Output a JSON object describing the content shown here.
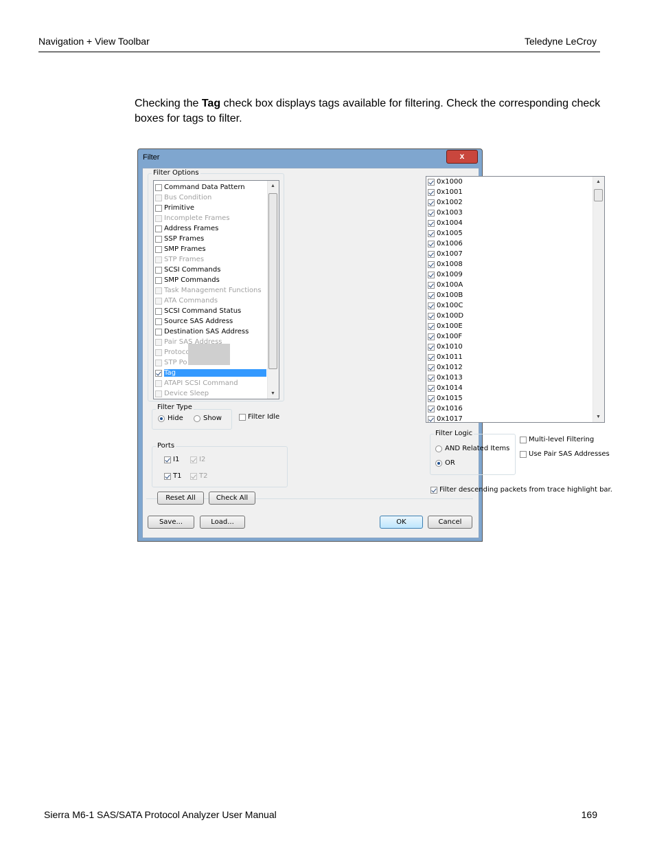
{
  "header": {
    "left": "Navigation + View Toolbar",
    "right": "Teledyne LeCroy"
  },
  "intro": {
    "before": "Checking the ",
    "bold": "Tag",
    "after": " check box displays tags available for filtering. Check the corresponding check boxes for tags to filter."
  },
  "dialog": {
    "title": "Filter",
    "close": "x",
    "filter_options_label": "Filter Options",
    "options": [
      {
        "label": "Command Data Pattern",
        "checked": false,
        "enabled": true
      },
      {
        "label": "Bus Condition",
        "checked": false,
        "enabled": false
      },
      {
        "label": "Primitive",
        "checked": false,
        "enabled": true
      },
      {
        "label": "Incomplete Frames",
        "checked": false,
        "enabled": false
      },
      {
        "label": "Address Frames",
        "checked": false,
        "enabled": true
      },
      {
        "label": "SSP Frames",
        "checked": false,
        "enabled": true
      },
      {
        "label": "SMP Frames",
        "checked": false,
        "enabled": true
      },
      {
        "label": "STP Frames",
        "checked": false,
        "enabled": false
      },
      {
        "label": "SCSI Commands",
        "checked": false,
        "enabled": true
      },
      {
        "label": "SMP Commands",
        "checked": false,
        "enabled": true
      },
      {
        "label": "Task Management Functions",
        "checked": false,
        "enabled": false
      },
      {
        "label": "ATA Commands",
        "checked": false,
        "enabled": false
      },
      {
        "label": "SCSI Command Status",
        "checked": false,
        "enabled": true
      },
      {
        "label": "Source SAS Address",
        "checked": false,
        "enabled": true
      },
      {
        "label": "Destination SAS Address",
        "checked": false,
        "enabled": true
      },
      {
        "label": "Pair SAS Address",
        "checked": false,
        "enabled": false
      },
      {
        "label": "Protoco",
        "checked": false,
        "enabled": false
      },
      {
        "label": "STP Po",
        "checked": false,
        "enabled": false
      },
      {
        "label": "Tag",
        "checked": true,
        "enabled": true,
        "selected": true
      },
      {
        "label": "ATAPI SCSI Command",
        "checked": false,
        "enabled": false
      },
      {
        "label": "Device Sleep",
        "checked": false,
        "enabled": false
      }
    ],
    "tags": [
      "0x1000",
      "0x1001",
      "0x1002",
      "0x1003",
      "0x1004",
      "0x1005",
      "0x1006",
      "0x1007",
      "0x1008",
      "0x1009",
      "0x100A",
      "0x100B",
      "0x100C",
      "0x100D",
      "0x100E",
      "0x100F",
      "0x1010",
      "0x1011",
      "0x1012",
      "0x1013",
      "0x1014",
      "0x1015",
      "0x1016",
      "0x1017"
    ],
    "filter_type": {
      "label": "Filter Type",
      "hide": "Hide",
      "show": "Show",
      "selected": "Hide"
    },
    "filter_idle": "Filter Idle",
    "ports": {
      "label": "Ports",
      "items": [
        {
          "label": "I1",
          "checked": true,
          "enabled": true
        },
        {
          "label": "I2",
          "checked": true,
          "enabled": false
        },
        {
          "label": "T1",
          "checked": true,
          "enabled": true
        },
        {
          "label": "T2",
          "checked": true,
          "enabled": false
        }
      ]
    },
    "filter_logic": {
      "label": "Filter Logic",
      "and": "AND Related Items",
      "or": "OR",
      "selected": "OR"
    },
    "multi_level": "Multi-level Filtering",
    "use_pair_sas": "Use Pair SAS Addresses",
    "filter_descending": "Filter descending packets from trace highlight bar.",
    "buttons": {
      "reset_all": "Reset All",
      "check_all": "Check All",
      "save": "Save...",
      "load": "Load...",
      "ok": "OK",
      "cancel": "Cancel"
    }
  },
  "footer": {
    "left": "Sierra M6-1 SAS/SATA Protocol Analyzer User Manual",
    "right": "169"
  }
}
